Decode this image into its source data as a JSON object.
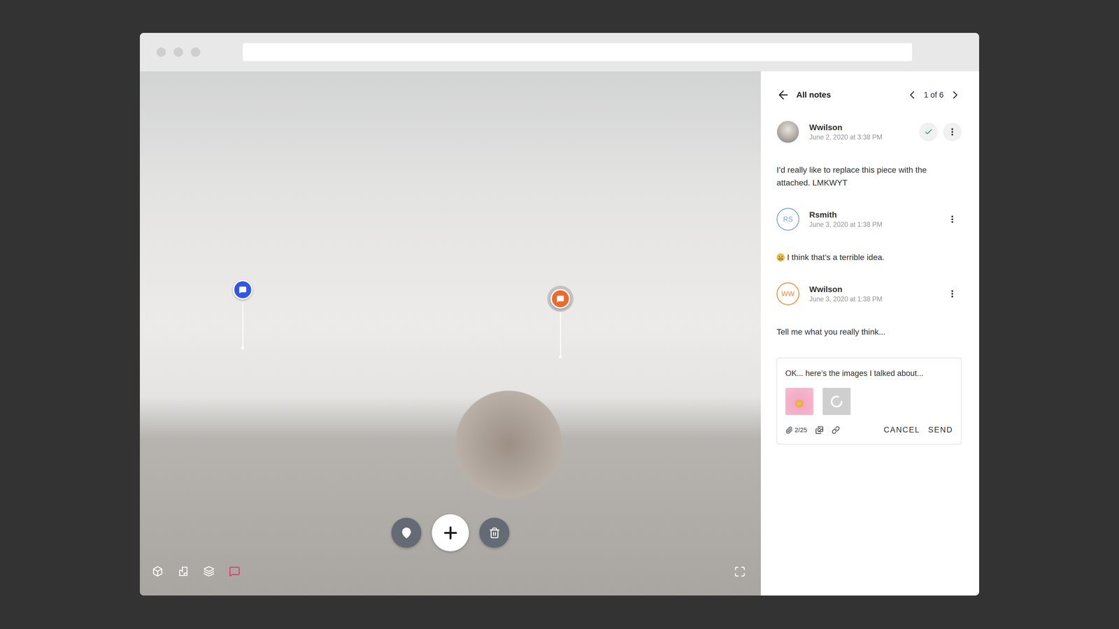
{
  "viewer": {
    "pins": [
      {
        "color": "#3156e8",
        "selected": false
      },
      {
        "color": "#ee6a2c",
        "selected": true
      }
    ],
    "actions": [
      {
        "kind": "pin"
      },
      {
        "kind": "add"
      },
      {
        "kind": "delete"
      }
    ],
    "tools": [
      {
        "kind": "dollhouse",
        "selected": false
      },
      {
        "kind": "floorplan",
        "selected": false
      },
      {
        "kind": "layers",
        "selected": false
      },
      {
        "kind": "notes",
        "selected": true
      }
    ]
  },
  "notes": {
    "back": "All notes",
    "pager": "1 of 6"
  },
  "comments": [
    {
      "author": "Wwilson",
      "date": "June 2, 2020 at 3:38 PM",
      "avatar": "photo",
      "initials": "",
      "color": "#999999",
      "resolved": true,
      "emoji": false,
      "text": "I’d really like to replace this piece with the attached. LMKWYT"
    },
    {
      "author": "Rsmith",
      "date": "June 3, 2020 at 1:38 PM",
      "avatar": "initials",
      "initials": "RS",
      "color": "#7ea6dc",
      "resolved": false,
      "emoji": true,
      "text": "I think that’s a terrible idea."
    },
    {
      "author": "Wwilson",
      "date": "June 3, 2020 at 1:38 PM",
      "avatar": "initials",
      "initials": "WW",
      "color": "#f0913f",
      "resolved": false,
      "emoji": false,
      "text": "Tell me what you really think..."
    }
  ],
  "reply": {
    "text": "OK... here’s the images I talked about...",
    "attachments": [
      {
        "kind": "image"
      },
      {
        "kind": "loading"
      }
    ],
    "count": "2/25",
    "cancel": "CANCEL",
    "send": "SEND"
  }
}
